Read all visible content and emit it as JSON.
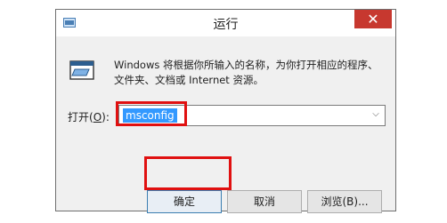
{
  "window": {
    "title": "运行",
    "close_glyph": "✕"
  },
  "description": {
    "line1": "Windows 将根据你所输入的名称，为你打开相应的程序、",
    "line2": "文件夹、文档或 Internet 资源。"
  },
  "open_field": {
    "label_prefix": "打开(",
    "label_key": "O",
    "label_suffix": "):",
    "value": "msconfig"
  },
  "buttons": {
    "ok": "确定",
    "cancel": "取消",
    "browse": "浏览(B)..."
  },
  "colors": {
    "highlight": "#e01010",
    "selection": "#3399ff",
    "close_button": "#c7382f"
  }
}
